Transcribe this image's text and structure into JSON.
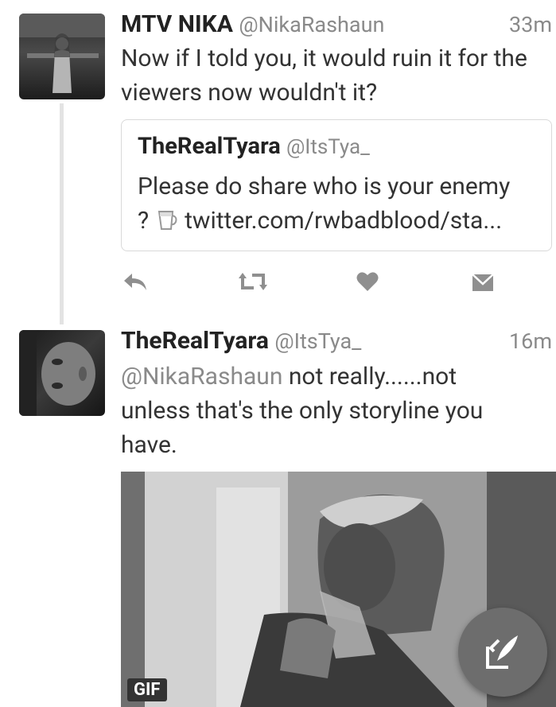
{
  "tweet1": {
    "name": "MTV NIKA",
    "handle": "@NikaRashaun",
    "time": "33m",
    "text_line1": "Now if I told you, it would ruin it for the",
    "text_line2": "viewers now wouldn't it?",
    "quote": {
      "name": "TheRealTyara",
      "handle": "@ItsTya_",
      "text_line1": "Please do share who is your enemy",
      "text_prefix": "?",
      "link": "twitter.com/rwbadblood/sta..."
    },
    "icons": {
      "reply": "reply-icon",
      "retweet": "retweet-icon",
      "like": "heart-icon",
      "message": "direct-message-icon",
      "quote_emoji": "coffee-cup-icon"
    }
  },
  "tweet2": {
    "name": "TheRealTyara",
    "handle": "@ItsTya_",
    "time": "16m",
    "mention": "@NikaRashaun",
    "text_line1_rest": " not really......not",
    "text_line2": "unless that's the only storyline you",
    "text_line3": "have.",
    "media_badge": "GIF"
  },
  "fab": {
    "icon": "compose-tweet-icon"
  }
}
